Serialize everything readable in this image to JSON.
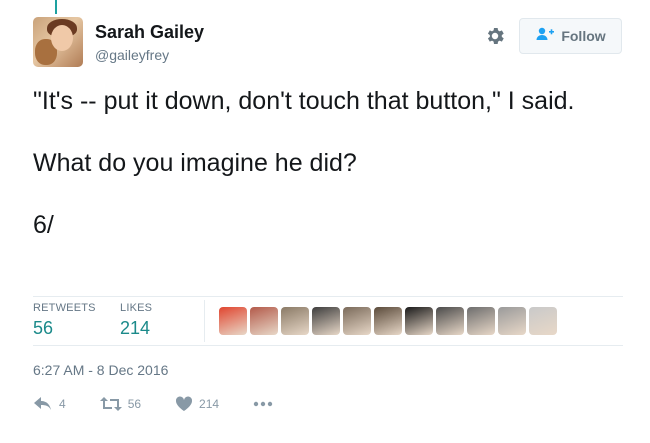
{
  "user": {
    "name": "Sarah Gailey",
    "handle": "@gaileyfrey"
  },
  "header": {
    "follow_label": "Follow"
  },
  "tweet": {
    "paragraphs": [
      "\"It's -- put it down, don't touch that button,\" I said.",
      "What do you imagine he did?",
      "6/"
    ]
  },
  "stats": {
    "retweets_label": "RETWEETS",
    "retweets_count": "56",
    "likes_label": "LIKES",
    "likes_count": "214"
  },
  "likers": [
    {
      "icon": "liker-avatar",
      "color": "#e0452f"
    },
    {
      "icon": "liker-avatar",
      "color": "#b35a4a"
    },
    {
      "icon": "liker-avatar",
      "color": "#8a7a66"
    },
    {
      "icon": "liker-avatar",
      "color": "#3d3d3d"
    },
    {
      "icon": "liker-avatar",
      "color": "#7a6a5a"
    },
    {
      "icon": "liker-avatar",
      "color": "#5a4a3a"
    },
    {
      "icon": "liker-avatar",
      "color": "#1a1a1a"
    },
    {
      "icon": "liker-avatar",
      "color": "#4a4a4a"
    },
    {
      "icon": "liker-avatar",
      "color": "#6d6d6d"
    },
    {
      "icon": "liker-avatar",
      "color": "#9a9a9a"
    },
    {
      "icon": "liker-avatar",
      "color": "#c9c9c9"
    }
  ],
  "timestamp": "6:27 AM - 8 Dec 2016",
  "actions": {
    "reply_count": "4",
    "retweet_count": "56",
    "like_count": "214"
  },
  "colors": {
    "accent": "#1b8a8a",
    "muted": "#657786"
  }
}
